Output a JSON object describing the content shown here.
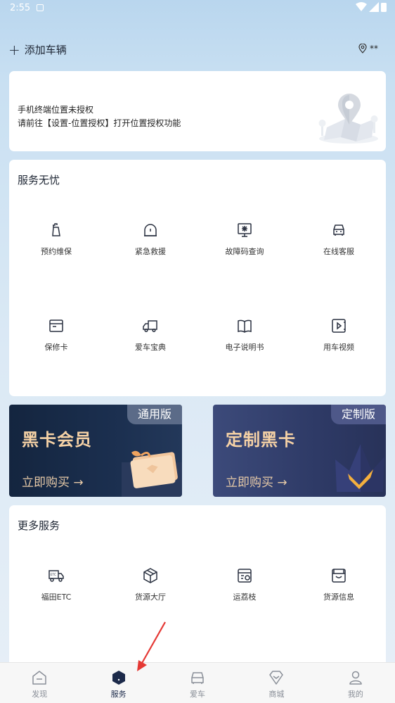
{
  "status_bar": {
    "time": "2:55"
  },
  "header": {
    "add_vehicle_label": "添加车辆",
    "location_label": "**"
  },
  "location_notice": {
    "line1": "手机终端位置未授权",
    "line2": "请前往【设置-位置授权】打开位置授权功能"
  },
  "services": {
    "title": "服务无忧",
    "items": [
      {
        "label": "预约维保",
        "icon": "maintenance-icon"
      },
      {
        "label": "紧急救援",
        "icon": "rescue-icon"
      },
      {
        "label": "故障码查询",
        "icon": "fault-code-icon"
      },
      {
        "label": "在线客服",
        "icon": "customer-service-icon"
      },
      {
        "label": "保修卡",
        "icon": "warranty-card-icon"
      },
      {
        "label": "爱车宝典",
        "icon": "truck-icon"
      },
      {
        "label": "电子说明书",
        "icon": "manual-book-icon"
      },
      {
        "label": "用车视频",
        "icon": "video-icon"
      }
    ]
  },
  "promos": [
    {
      "tag": "通用版",
      "title": "黑卡会员",
      "buy": "立即购买 →"
    },
    {
      "tag": "定制版",
      "title": "定制黑卡",
      "buy": "立即购买 →"
    }
  ],
  "more_services": {
    "title": "更多服务",
    "items": [
      {
        "label": "福田ETC",
        "icon": "etc-truck-icon"
      },
      {
        "label": "货源大厅",
        "icon": "package-icon"
      },
      {
        "label": "运荔枝",
        "icon": "shipping-icon"
      },
      {
        "label": "货源信息",
        "icon": "cargo-info-icon"
      }
    ]
  },
  "bottom_nav": {
    "active_index": 1,
    "items": [
      {
        "label": "发现",
        "icon": "discover-icon"
      },
      {
        "label": "服务",
        "icon": "service-icon"
      },
      {
        "label": "爱车",
        "icon": "car-icon"
      },
      {
        "label": "商城",
        "icon": "mall-diamond-icon"
      },
      {
        "label": "我的",
        "icon": "profile-icon"
      }
    ]
  },
  "colors": {
    "accent_dark": "#1c2a4a",
    "promo_gold": "#f6d2a6",
    "annotation_red": "#e53935"
  }
}
